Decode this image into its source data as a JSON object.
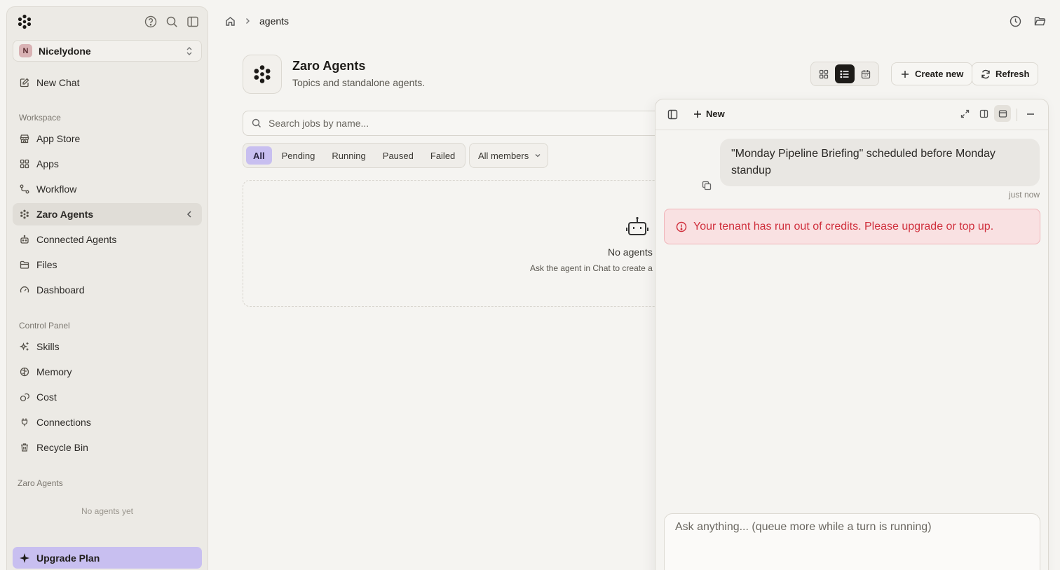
{
  "sidebar": {
    "workspace": {
      "initial": "N",
      "name": "Nicelydone"
    },
    "new_chat": "New Chat",
    "workspace_label": "Workspace",
    "workspace_items": [
      {
        "label": "App Store",
        "icon": "store-icon"
      },
      {
        "label": "Apps",
        "icon": "grid-icon"
      },
      {
        "label": "Workflow",
        "icon": "workflow-icon"
      },
      {
        "label": "Zaro Agents",
        "icon": "agents-icon",
        "active": true
      },
      {
        "label": "Connected Agents",
        "icon": "robot-icon"
      },
      {
        "label": "Files",
        "icon": "folder-icon"
      },
      {
        "label": "Dashboard",
        "icon": "gauge-icon"
      }
    ],
    "control_label": "Control Panel",
    "control_items": [
      {
        "label": "Skills",
        "icon": "sparkles-icon"
      },
      {
        "label": "Memory",
        "icon": "brain-icon"
      },
      {
        "label": "Cost",
        "icon": "coins-icon"
      },
      {
        "label": "Connections",
        "icon": "plug-icon"
      },
      {
        "label": "Recycle Bin",
        "icon": "trash-icon"
      }
    ],
    "agents_label": "Zaro Agents",
    "agents_empty": "No agents yet",
    "upgrade": "Upgrade Plan"
  },
  "header": {
    "breadcrumb": "agents"
  },
  "page": {
    "title": "Zaro Agents",
    "subtitle": "Topics and standalone agents.",
    "create_new": "Create new",
    "refresh": "Refresh",
    "active_view": "list",
    "search_placeholder": "Search jobs by name...",
    "filters": [
      "All",
      "Pending",
      "Running",
      "Paused",
      "Failed"
    ],
    "active_filter": "All",
    "members": "All members",
    "empty_title": "No agents y",
    "empty_sub": "Ask the agent in Chat to create a t"
  },
  "chat": {
    "new_label": "New",
    "message": "\"Monday Pipeline Briefing\" scheduled before Monday standup",
    "message_time": "just now",
    "error": "Your tenant has run out of credits. Please upgrade or top up.",
    "input_placeholder": "Ask anything... (queue more while a turn is running)"
  },
  "colors": {
    "accent": "#c8bff0",
    "error_text": "#d0303d",
    "error_bg": "#f9e1e2"
  }
}
